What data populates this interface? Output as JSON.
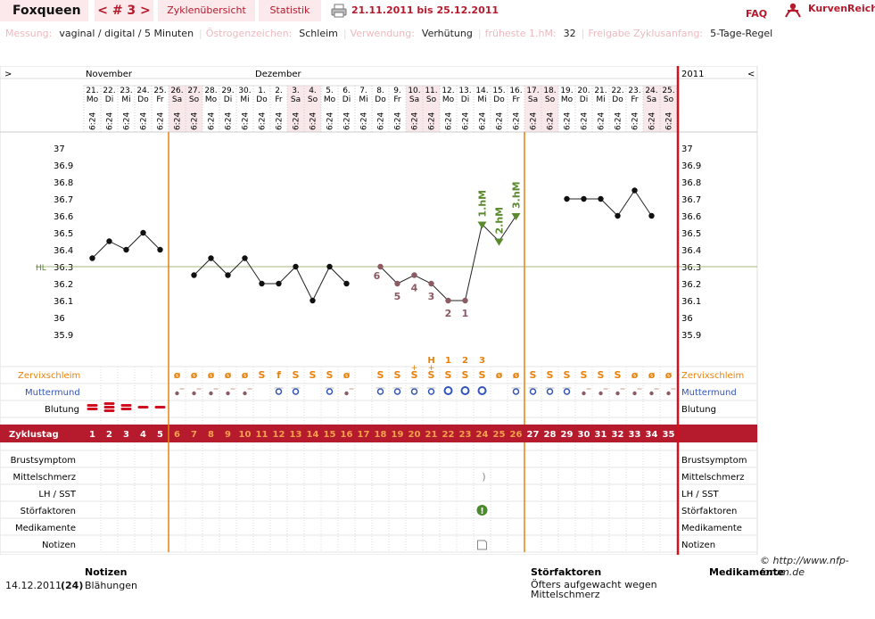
{
  "topbar": {
    "brand": "Foxqueen",
    "nav": "< # 3 >",
    "tab_overview": "Zyklenübersicht",
    "tab_stats": "Statistik",
    "date_range": "21.11.2011 bis 25.12.2011",
    "faq": "FAQ",
    "logo": "KurvenReich"
  },
  "info": [
    {
      "label": "Messung:",
      "value": "vaginal / digital / 5 Minuten"
    },
    {
      "label": "Östrogenzeichen:",
      "value": "Schleim"
    },
    {
      "label": "Verwendung:",
      "value": "Verhütung"
    },
    {
      "label": "früheste 1.hM:",
      "value": "32"
    },
    {
      "label": "Freigabe Zyklusanfang:",
      "value": "5-Tage-Regel"
    }
  ],
  "chart": {
    "nav_left": ">",
    "nav_right": "<",
    "year": "2011",
    "months": [
      {
        "name": "November",
        "day": 1
      },
      {
        "name": "Dezember",
        "day": 11
      }
    ],
    "dates": [
      [
        "21.",
        "Mo"
      ],
      [
        "22.",
        "Di"
      ],
      [
        "23.",
        "Mi"
      ],
      [
        "24.",
        "Do"
      ],
      [
        "25.",
        "Fr"
      ],
      [
        "26.",
        "Sa"
      ],
      [
        "27.",
        "So"
      ],
      [
        "28.",
        "Mo"
      ],
      [
        "29.",
        "Di"
      ],
      [
        "30.",
        "Mi"
      ],
      [
        "1.",
        "Do"
      ],
      [
        "2.",
        "Fr"
      ],
      [
        "3.",
        "Sa"
      ],
      [
        "4.",
        "So"
      ],
      [
        "5.",
        "Mo"
      ],
      [
        "6.",
        "Di"
      ],
      [
        "7.",
        "Mi"
      ],
      [
        "8.",
        "Do"
      ],
      [
        "9.",
        "Fr"
      ],
      [
        "10.",
        "Sa"
      ],
      [
        "11.",
        "So"
      ],
      [
        "12.",
        "Mo"
      ],
      [
        "13.",
        "Di"
      ],
      [
        "14.",
        "Mi"
      ],
      [
        "15.",
        "Do"
      ],
      [
        "16.",
        "Fr"
      ],
      [
        "17.",
        "Sa"
      ],
      [
        "18.",
        "So"
      ],
      [
        "19.",
        "Mo"
      ],
      [
        "20.",
        "Di"
      ],
      [
        "21.",
        "Mi"
      ],
      [
        "22.",
        "Do"
      ],
      [
        "23.",
        "Fr"
      ],
      [
        "24.",
        "Sa"
      ],
      [
        "25.",
        "So"
      ]
    ],
    "weekend_days": [
      6,
      7,
      13,
      14,
      20,
      21,
      27,
      28,
      34,
      35
    ],
    "time": "6:24",
    "y_ticks": [
      "37",
      "36.9",
      "36.8",
      "36.7",
      "36.6",
      "36.5",
      "36.4",
      "36.3",
      "36.2",
      "36.1",
      "36",
      "35.9"
    ],
    "hl_label": "HL",
    "hl_value": 36.3,
    "temps": [
      36.35,
      36.45,
      36.4,
      36.5,
      36.4,
      null,
      36.25,
      36.35,
      36.25,
      36.35,
      36.2,
      36.2,
      36.3,
      36.1,
      36.3,
      36.2,
      null,
      36.3,
      36.2,
      36.25,
      36.2,
      36.1,
      36.1,
      36.55,
      36.45,
      36.6,
      null,
      null,
      36.7,
      36.7,
      36.7,
      36.6,
      36.75,
      36.6,
      null
    ],
    "low_labels": [
      {
        "day": 18,
        "text": "6"
      },
      {
        "day": 19,
        "text": "5"
      },
      {
        "day": 20,
        "text": "4"
      },
      {
        "day": 21,
        "text": "3"
      },
      {
        "day": 22,
        "text": "2"
      },
      {
        "day": 23,
        "text": "1"
      }
    ],
    "high_labels": [
      {
        "day": 24,
        "text": "1.hM"
      },
      {
        "day": 25,
        "text": "2.hM"
      },
      {
        "day": 26,
        "text": "3.hM"
      }
    ],
    "cervix_peak": [
      {
        "day": 21,
        "text": "H"
      },
      {
        "day": 22,
        "text": "1"
      },
      {
        "day": 23,
        "text": "2"
      },
      {
        "day": 24,
        "text": "3"
      }
    ],
    "cervix_plus_days": [
      20,
      21
    ],
    "mucus_label": "Zervixschleim",
    "mucus": [
      "",
      "",
      "",
      "",
      "",
      "ø",
      "ø",
      "ø",
      "ø",
      "ø",
      "S",
      "f",
      "S",
      "S",
      "S",
      "ø",
      "",
      "S",
      "S",
      "S",
      "S",
      "S",
      "S",
      "S",
      "ø",
      "ø",
      "S",
      "S",
      "S",
      "S",
      "S",
      "S",
      "ø",
      "ø",
      "ø"
    ],
    "cervix_label": "Muttermund",
    "cervix": [
      "",
      "",
      "",
      "",
      "",
      "d",
      "d",
      "d",
      "d",
      "d",
      "",
      "r",
      "r",
      "",
      "r",
      "d",
      "",
      "r",
      "r",
      "r",
      "r",
      "R",
      "R",
      "R",
      "",
      "r",
      "r",
      "r",
      "r",
      "d",
      "d",
      "d",
      "d",
      "d",
      "d"
    ],
    "bleeding_label": "Blutung",
    "bleeding": [
      2,
      3,
      2,
      1,
      1
    ],
    "cycle_label": "Zyklustag",
    "cycle_days": [
      "1",
      "2",
      "3",
      "4",
      "5",
      "6",
      "7",
      "8",
      "9",
      "10",
      "11",
      "12",
      "13",
      "14",
      "15",
      "16",
      "17",
      "18",
      "19",
      "20",
      "21",
      "22",
      "23",
      "24",
      "25",
      "26",
      "27",
      "28",
      "29",
      "30",
      "31",
      "32",
      "33",
      "34",
      "35"
    ],
    "extra_rows": [
      "Brustsymptom",
      "Mittelschmerz",
      "LH / SST",
      "Störfaktoren",
      "Medikamente",
      "Notizen"
    ],
    "colors": {
      "accent": "#b51a2d",
      "orange": "#e8820c",
      "green": "#5a8a2c",
      "blue": "#3355bb",
      "marker": "#8b5a63"
    }
  },
  "copyright": "http://www.nfp-forum.de",
  "copyright_sym": "©",
  "footer": {
    "notes_header": "Notizen",
    "stoer_header": "Störfaktoren",
    "med_header": "Medikamente",
    "date": "14.12.2011",
    "day": "(24)",
    "note": "Blähungen",
    "stoer_line1": "Öfters aufgewacht wegen",
    "stoer_line2": "Mittelschmerz"
  }
}
